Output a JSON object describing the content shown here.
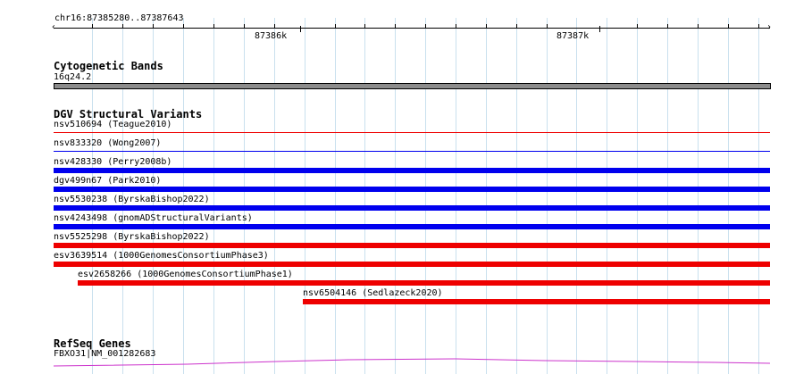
{
  "ruler": {
    "region_label": "chr16:87385280..87387643",
    "major_labels": [
      "87386k",
      "87387k"
    ]
  },
  "tracks": {
    "cyto": {
      "title": "Cytogenetic Bands",
      "band_label": "16q24.2",
      "band_color": "#8c8c8c"
    },
    "dgv": {
      "title": "DGV Structural Variants",
      "colors": {
        "gain": "#0000ee",
        "loss": "#ee0000",
        "thin_loss": "#ee0000",
        "thin_gain": "#0000ee"
      },
      "features": [
        {
          "label": "nsv510694 (Teague2010)",
          "type": "loss"
        },
        {
          "label": "nsv833320 (Wong2007)",
          "type": "gain"
        },
        {
          "label": "nsv428330 (Perry2008b)",
          "type": "gain"
        },
        {
          "label": "dgv499n67 (Park2010)",
          "type": "gain"
        },
        {
          "label": "nsv5530238 (ByrskaBishop2022)",
          "type": "gain"
        },
        {
          "label": "nsv4243498 (gnomADStructuralVariants)",
          "type": "gain"
        },
        {
          "label": "nsv5525298 (ByrskaBishop2022)",
          "type": "loss"
        },
        {
          "label": "esv3639514 (1000GenomesConsortiumPhase3)",
          "type": "loss"
        },
        {
          "label": "esv2658266 (1000GenomesConsortiumPhase1)",
          "type": "loss"
        },
        {
          "label": "nsv6504146 (Sedlazeck2020)",
          "type": "loss"
        }
      ]
    },
    "refseq": {
      "title": "RefSeq Genes",
      "gene_label": "FBXO31|NM_001282683",
      "color": "#cc33cc"
    }
  }
}
